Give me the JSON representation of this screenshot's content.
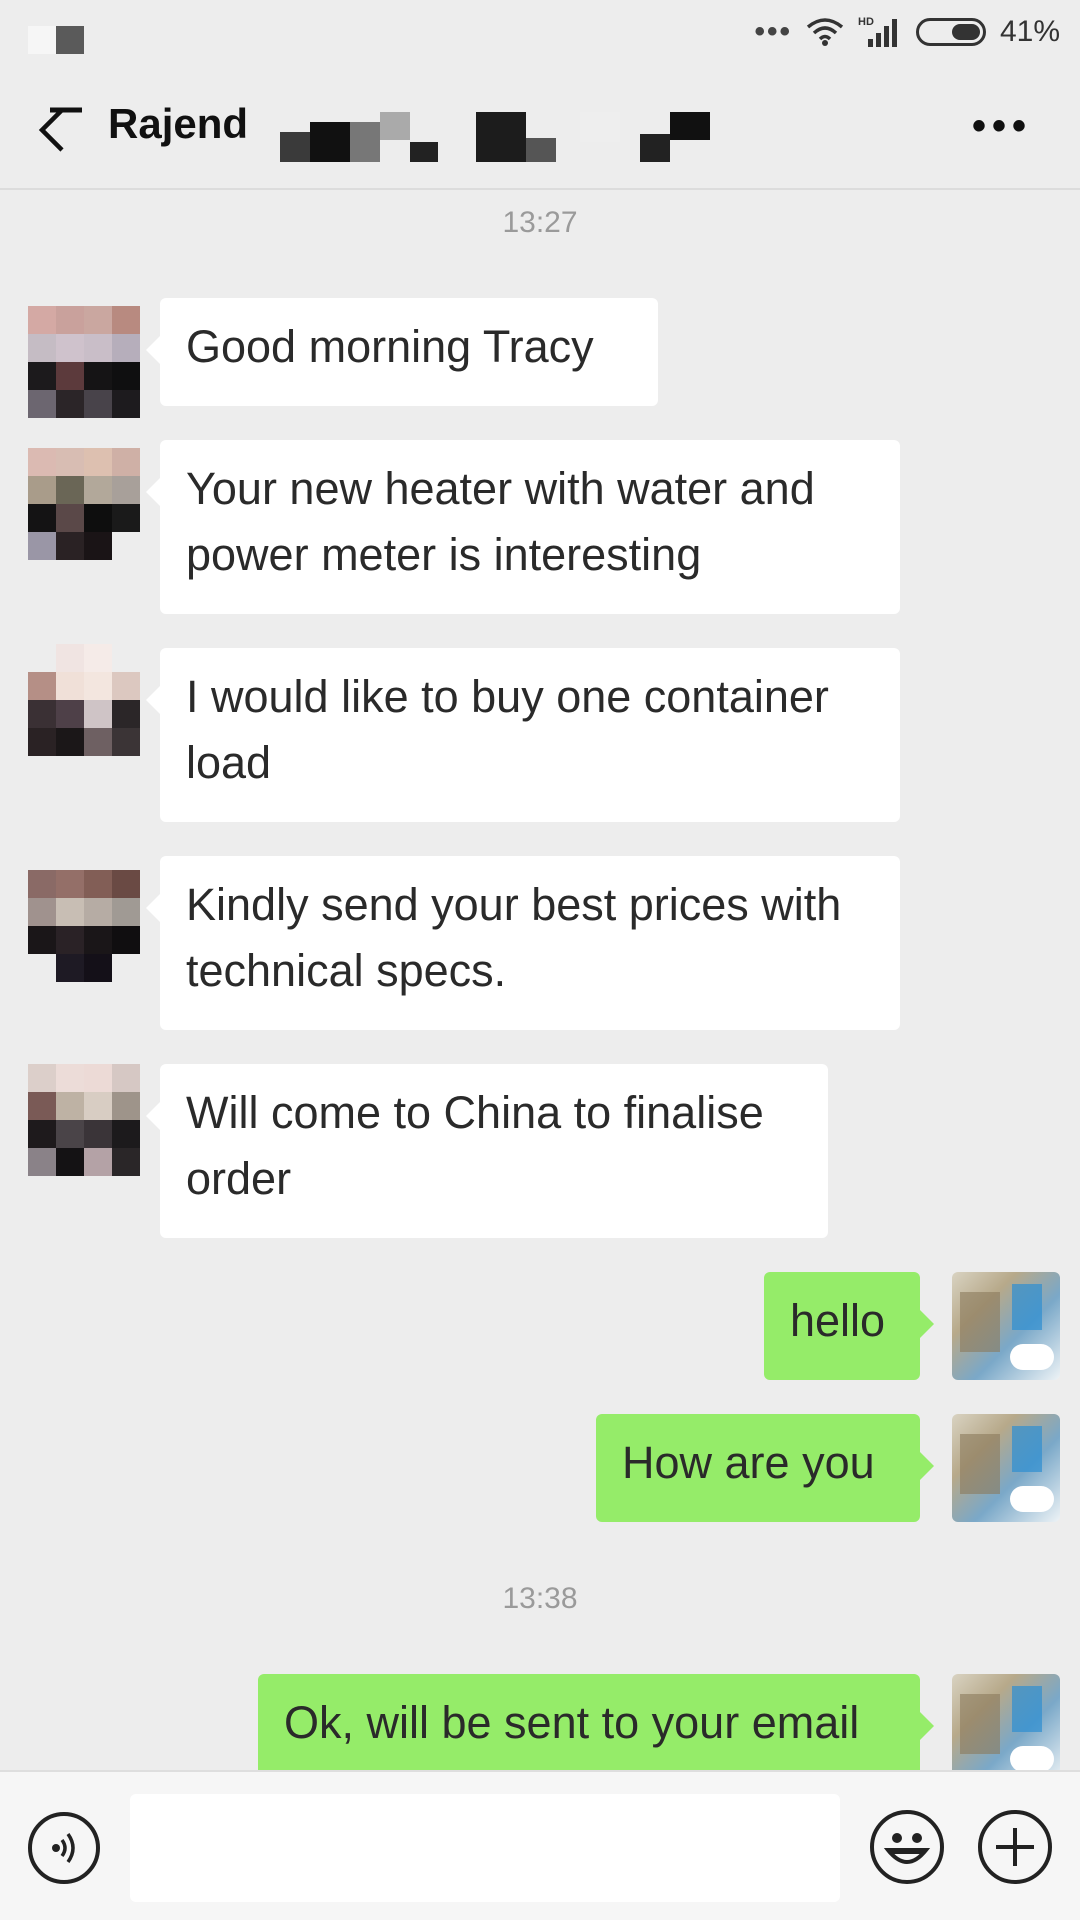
{
  "status_bar": {
    "battery_text": "41%",
    "network_label": "HD"
  },
  "header": {
    "title": "Rajend"
  },
  "timestamps": [
    "13:27",
    "13:38"
  ],
  "messages": [
    {
      "from": "contact",
      "text": "Good morning Tracy"
    },
    {
      "from": "contact",
      "text": "Your new heater with water and power meter is interesting"
    },
    {
      "from": "contact",
      "text": "I would like to buy one container load"
    },
    {
      "from": "contact",
      "text": "Kindly send your best prices with technical specs."
    },
    {
      "from": "contact",
      "text": "Will come to China to finalise order"
    },
    {
      "from": "me",
      "text": "hello"
    },
    {
      "from": "me",
      "text": "How are you"
    },
    {
      "from": "me",
      "text": "Ok, will be sent to your email"
    }
  ],
  "colors": {
    "background": "#ededed",
    "incoming_bubble": "#ffffff",
    "outgoing_bubble": "#95ec69"
  },
  "icons": [
    "back-arrow-icon",
    "more-icon",
    "voice-icon",
    "emoji-icon",
    "plus-icon",
    "wifi-icon",
    "signal-icon",
    "battery-icon"
  ]
}
